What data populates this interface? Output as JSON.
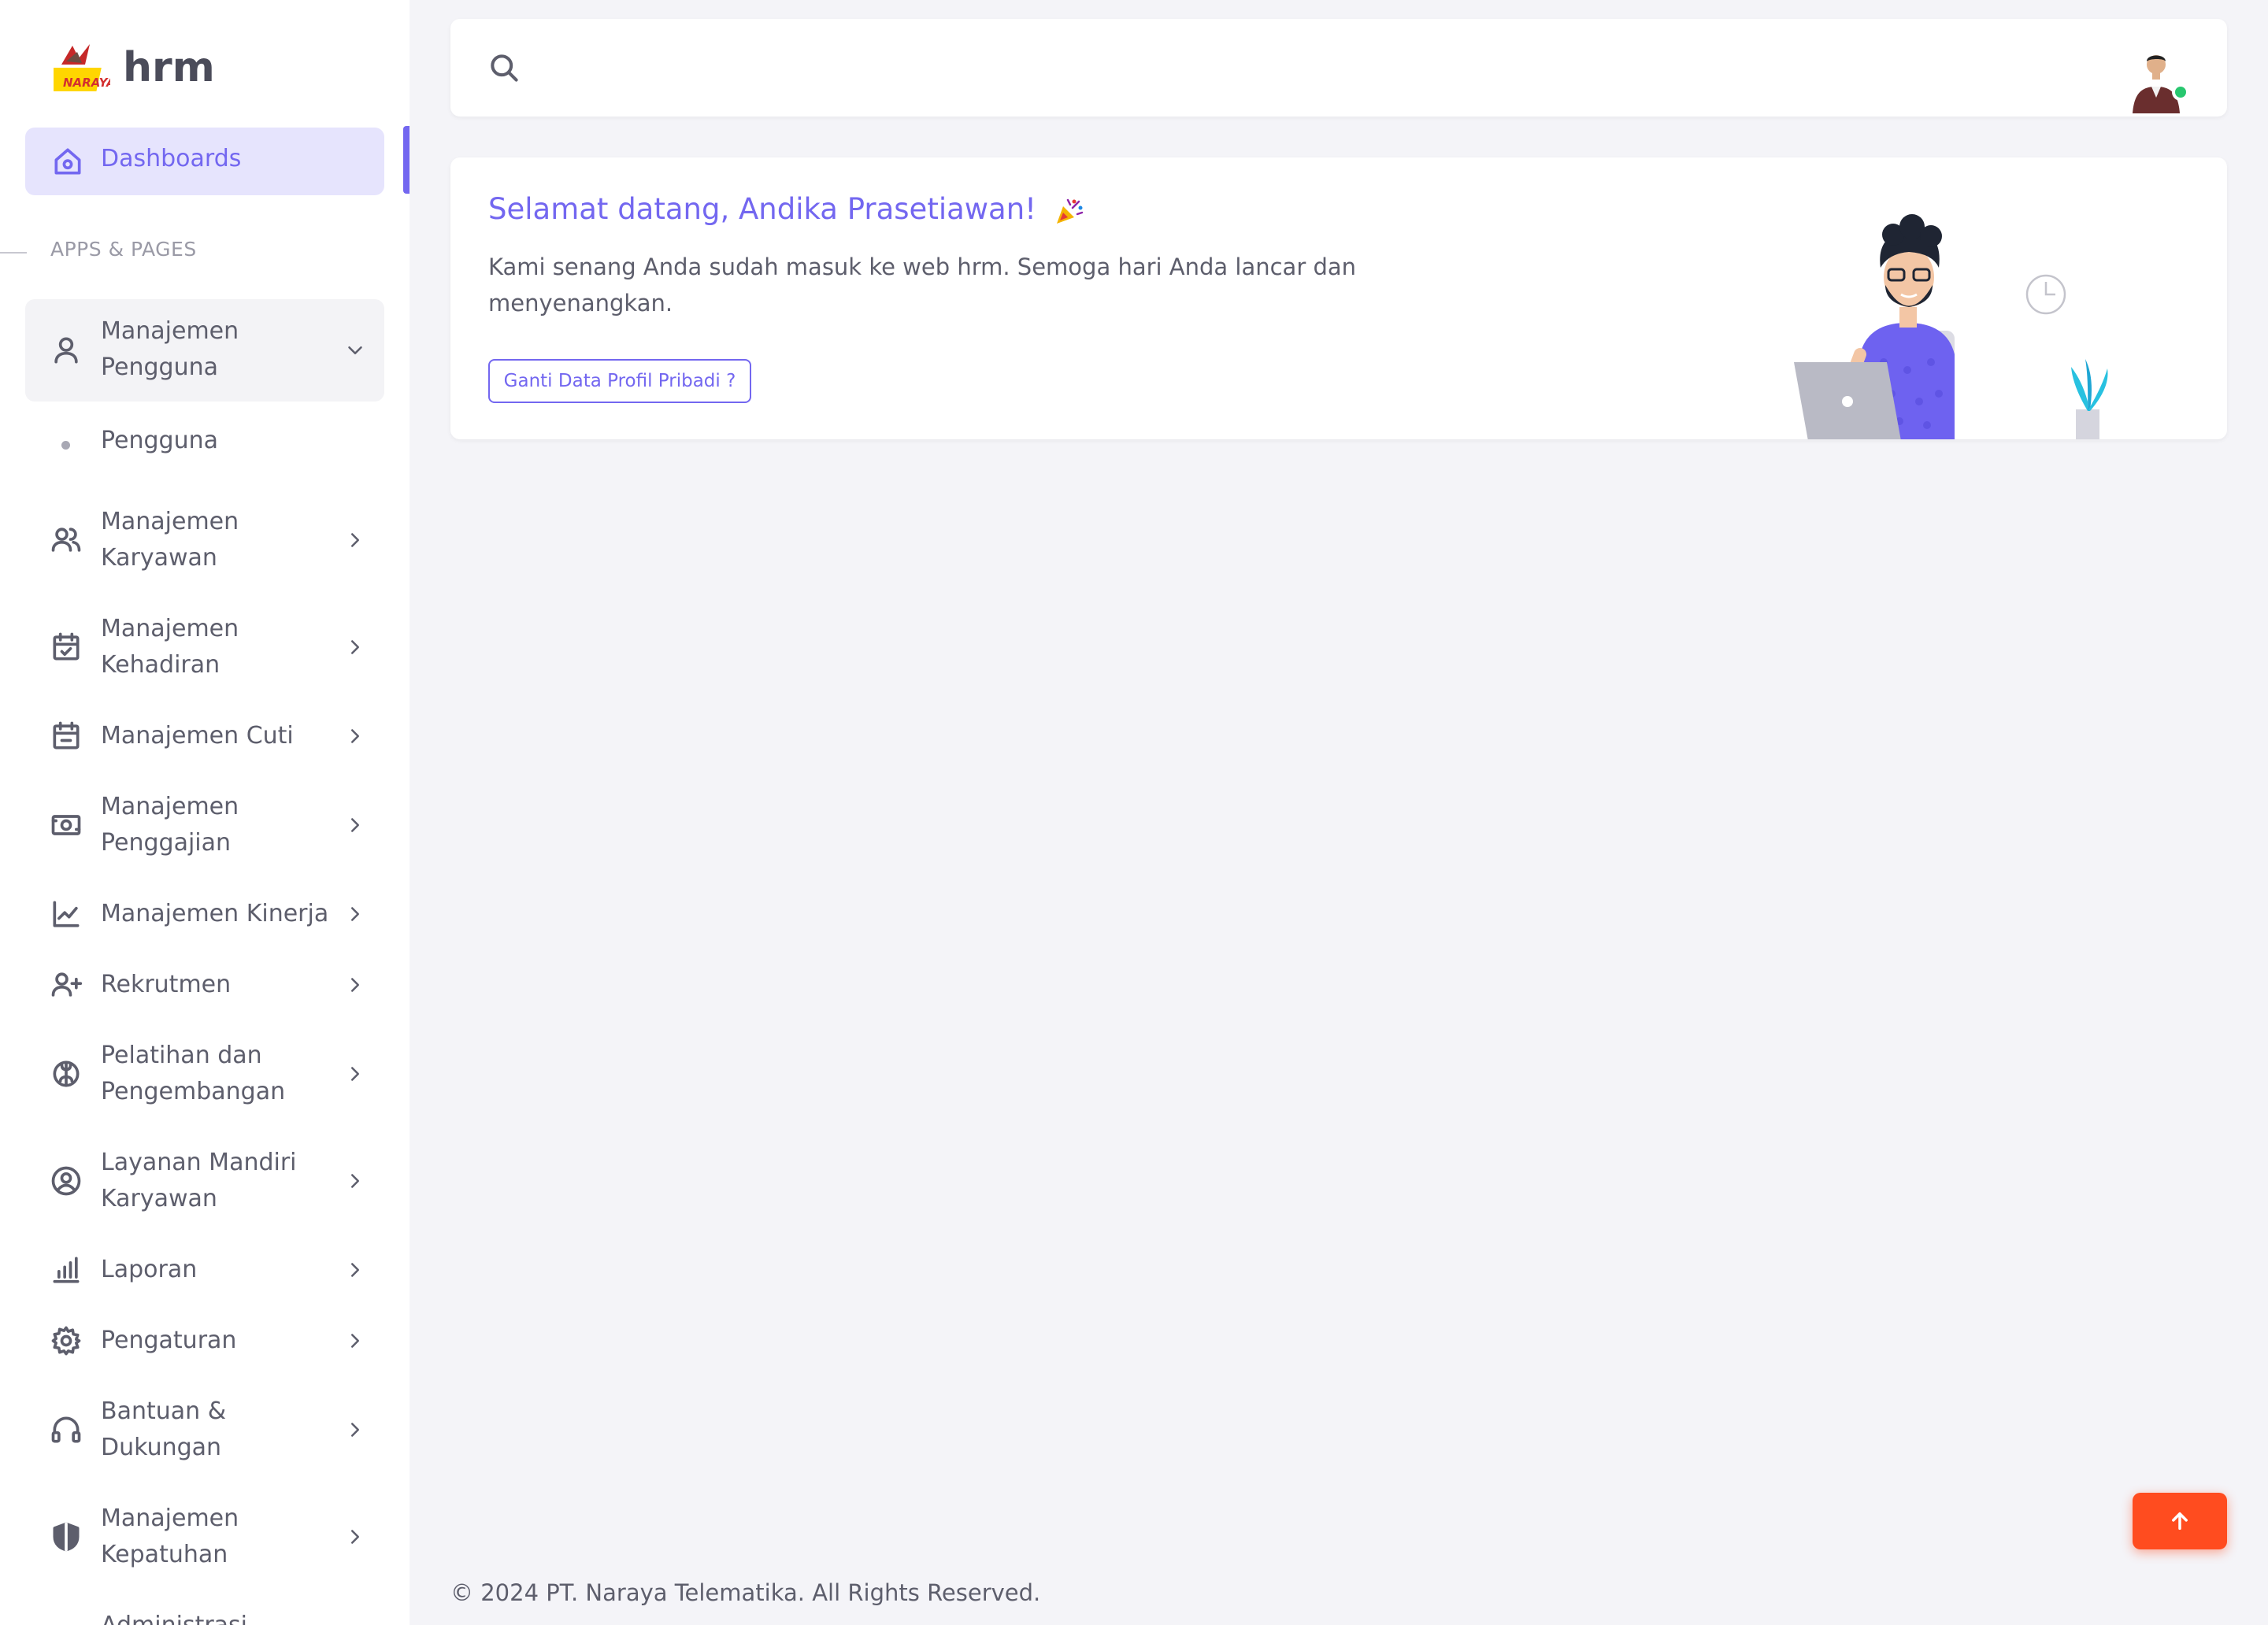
{
  "brand": {
    "name": "hrm",
    "logo_text": "NARAYA"
  },
  "sidebar": {
    "active": {
      "label": "Dashboards",
      "icon": "home-icon"
    },
    "section_header": "APPS & PAGES",
    "items": [
      {
        "label": "Manajemen\nPengguna",
        "icon": "user-icon",
        "expanded": true
      },
      {
        "label": "Manajemen\nKaryawan",
        "icon": "users-icon"
      },
      {
        "label": "Manajemen\nKehadiran",
        "icon": "calendar-check-icon"
      },
      {
        "label": "Manajemen Cuti",
        "icon": "calendar-minus-icon"
      },
      {
        "label": "Manajemen\nPenggajian",
        "icon": "money-icon"
      },
      {
        "label": "Manajemen Kinerja",
        "icon": "chart-line-icon"
      },
      {
        "label": "Rekrutmen",
        "icon": "user-plus-icon"
      },
      {
        "label": "Pelatihan dan\nPengembangan",
        "icon": "brain-icon"
      },
      {
        "label": "Layanan Mandiri\nKaryawan",
        "icon": "user-circle-icon"
      },
      {
        "label": "Laporan",
        "icon": "bar-chart-icon"
      },
      {
        "label": "Pengaturan",
        "icon": "gear-icon"
      },
      {
        "label": "Bantuan &\nDukungan",
        "icon": "headset-icon"
      },
      {
        "label": "Manajemen\nKepatuhan",
        "icon": "shield-icon"
      },
      {
        "label": "Administrasi",
        "icon": "folder-icon"
      }
    ],
    "sub_items": [
      {
        "label": "Pengguna"
      }
    ]
  },
  "search": {
    "placeholder": ""
  },
  "welcome": {
    "title": "Selamat datang, Andika Prasetiawan!",
    "text": "Kami senang Anda sudah masuk ke web hrm. Semoga hari Anda lancar dan menyenangkan.",
    "button_label": "Ganti Data Profil Pribadi ?"
  },
  "footer": {
    "text": "© 2024 PT. Naraya Telematika. All Rights Reserved."
  },
  "colors": {
    "primary": "#7367f0",
    "scroll_button": "#ff4c1f",
    "online": "#28c76f"
  }
}
